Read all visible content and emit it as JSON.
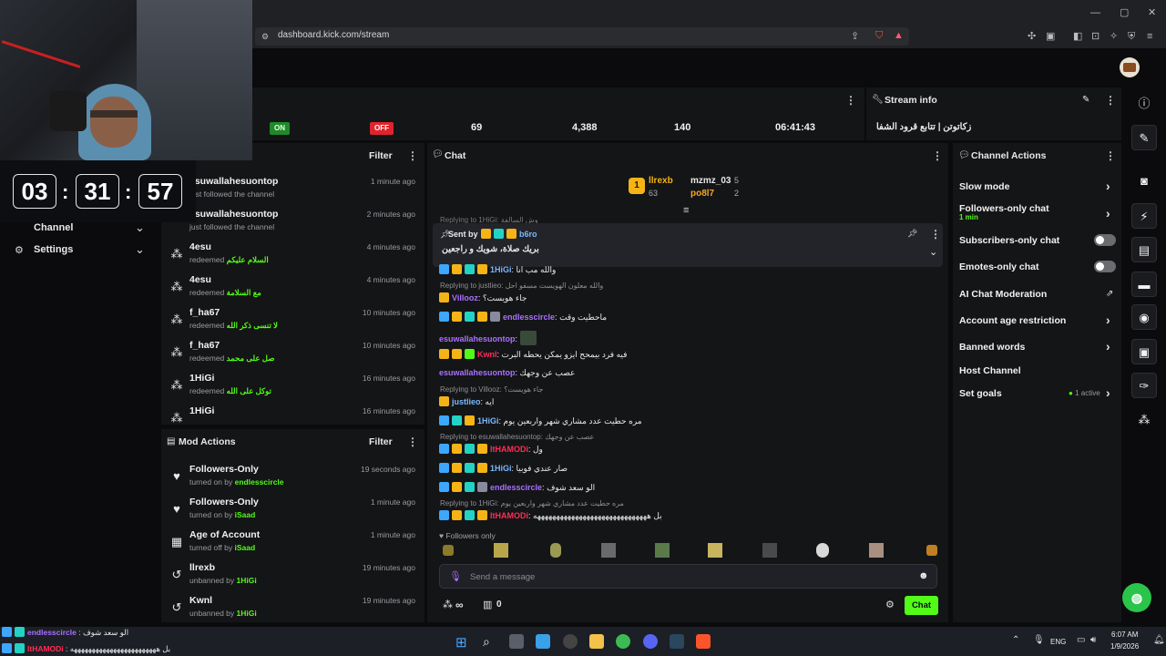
{
  "browser": {
    "url": "dashboard.kick.com/stream"
  },
  "timer": {
    "h": "03",
    "m": "31",
    "s": "57"
  },
  "sidebar": {
    "items": [
      {
        "label": "Channel"
      },
      {
        "label": "Settings"
      }
    ]
  },
  "stats": {
    "on": "ON",
    "off": "OFF",
    "values": [
      "69",
      "4,388",
      "140",
      "06:41:43"
    ]
  },
  "stream_info": {
    "title": "Stream info",
    "stream_title": "زكاتوتن | تتابع قرود الشفا"
  },
  "activity": {
    "filter": "Filter",
    "rows": [
      {
        "name": "esuwallahesuontop",
        "sub": "just followed the channel",
        "detail": "",
        "time": "1 minute ago"
      },
      {
        "name": "esuwallahesuontop",
        "sub": "just followed the channel",
        "detail": "",
        "time": "2 minutes ago"
      },
      {
        "name": "4esu",
        "sub": "redeemed",
        "detail": "السلام عليكم",
        "time": "4 minutes ago"
      },
      {
        "name": "4esu",
        "sub": "redeemed",
        "detail": "مع السلامة",
        "time": "4 minutes ago"
      },
      {
        "name": "f_ha67",
        "sub": "redeemed",
        "detail": "لا تنسى ذكر الله",
        "time": "10 minutes ago"
      },
      {
        "name": "f_ha67",
        "sub": "redeemed",
        "detail": "صل على محمد",
        "time": "10 minutes ago"
      },
      {
        "name": "1HiGi",
        "sub": "redeemed",
        "detail": "توكل على الله",
        "time": "16 minutes ago"
      },
      {
        "name": "1HiGi",
        "sub": "redeemed",
        "detail": "",
        "time": "16 minutes ago"
      }
    ]
  },
  "mod_actions": {
    "title": "Mod Actions",
    "filter": "Filter",
    "rows": [
      {
        "name": "Followers-Only",
        "sub": "turned on by",
        "by": "endlesscircle",
        "time": "19 seconds ago"
      },
      {
        "name": "Followers-Only",
        "sub": "turned on by",
        "by": "iSaad",
        "time": "1 minute ago"
      },
      {
        "name": "Age of Account",
        "sub": "turned off by",
        "by": "iSaad",
        "time": "1 minute ago"
      },
      {
        "name": "llrexb",
        "sub": "unbanned by",
        "by": "1HiGi",
        "time": "19 minutes ago"
      },
      {
        "name": "Kwnl",
        "sub": "unbanned by",
        "by": "1HiGi",
        "time": "19 minutes ago"
      }
    ]
  },
  "chat": {
    "title": "Chat",
    "leaderboard": {
      "rank": "1",
      "first_name": "llrexb",
      "first_pts": "63",
      "second_name": "mzmz_03",
      "second_pts": "5",
      "third_name": "po8l7",
      "third_pts": "2"
    },
    "replying_top": "Replying to 1HiGi: وش السالفة",
    "pinned": {
      "sent_by": "Sent by",
      "user": "b6ro",
      "text": "بريك صلاة، شويك و راجعين"
    },
    "messages": [
      {
        "reply": "",
        "user": "1HiGi",
        "text": "والله مب انا"
      },
      {
        "reply": "Replying to justlieo: والله معلون الهويست مسفو احل",
        "user": "Villooz",
        "text": "جاء هويست؟"
      },
      {
        "reply": "",
        "user": "endlesscircle",
        "text": "ماحطيت وقت"
      },
      {
        "reply": "",
        "user": "esuwallahesuontop",
        "text": ""
      },
      {
        "reply": "",
        "user": "Kwnl",
        "text": "فيه فرد بيمحح ايزو يمكن يحطه البرت"
      },
      {
        "reply": "",
        "user": "esuwallahesuontop",
        "text": "عصب عن وجهك"
      },
      {
        "reply": "Replying to Villooz: جاء هويست؟",
        "user": "justlieo",
        "text": "ايه"
      },
      {
        "reply": "",
        "user": "1HiGi",
        "text": "مره حطيت عدد مشاري شهر واربعين يوم"
      },
      {
        "reply": "Replying to esuwallahesuontop: عصب عن وجهك",
        "user": "ItHAMODi",
        "text": "ول"
      },
      {
        "reply": "",
        "user": "1HiGi",
        "text": "صار عندي فوبيا"
      },
      {
        "reply": "",
        "user": "endlesscircle",
        "text": "الو سعد شوف"
      },
      {
        "reply": "Replying to 1HiGi: مره حطيت عدد مشاري شهر واربعين يوم",
        "user": "ItHAMODi",
        "text": "بل ههههههههههههههههههههههههههههههه"
      }
    ],
    "followers_only": "Followers only",
    "placeholder": "Send a message",
    "points": "∞",
    "shop_count": "0",
    "send_label": "Chat"
  },
  "channel_actions": {
    "title": "Channel Actions",
    "items": [
      {
        "label": "Slow mode",
        "sub": ""
      },
      {
        "label": "Followers-only chat",
        "sub": "1 min"
      },
      {
        "label": "Subscribers-only chat",
        "sub": ""
      },
      {
        "label": "Emotes-only chat",
        "sub": ""
      },
      {
        "label": "AI Chat Moderation",
        "sub": ""
      },
      {
        "label": "Account age restriction",
        "sub": ""
      },
      {
        "label": "Banned words",
        "sub": ""
      },
      {
        "label": "Host Channel",
        "sub": ""
      },
      {
        "label": "Set goals",
        "sub": ""
      }
    ],
    "goals_status": "1 active"
  },
  "overlay": {
    "line1_user": "endlesscircle",
    "line1_text": ": الو سعد شوف",
    "line2_user": "ItHAMODi",
    "line2_text": ": بل ههههههههههههههههههههههههه"
  },
  "taskbar": {
    "lang": "ENG",
    "time": "6:07 AM",
    "date": "1/9/2026"
  },
  "colors": {
    "accent": "#53fc18",
    "panel": "#141517",
    "bg": "#0b0b0d"
  }
}
